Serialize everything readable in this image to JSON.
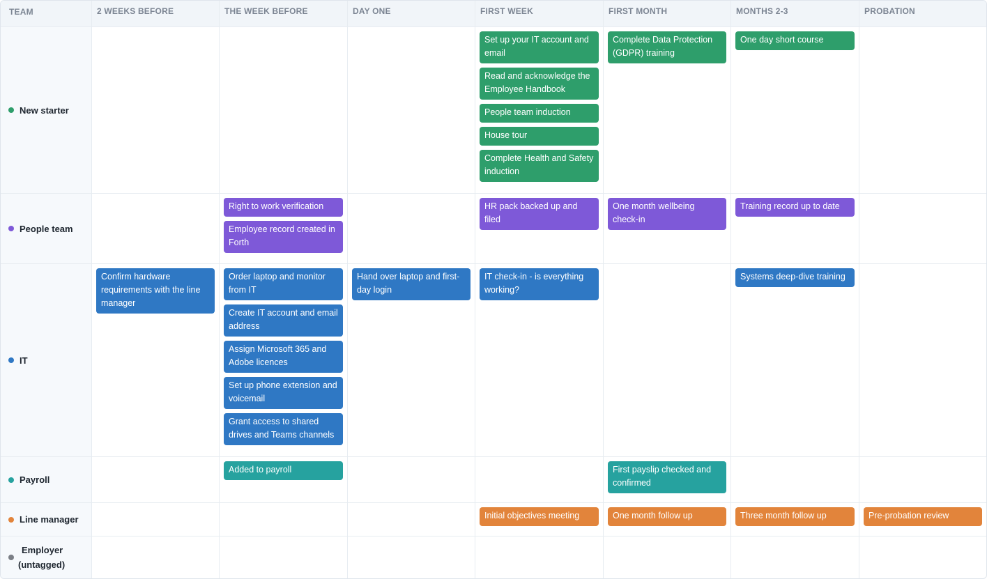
{
  "columns": {
    "team": "TEAM",
    "c1": "2 WEEKS BEFORE",
    "c2": "THE WEEK BEFORE",
    "c3": "DAY ONE",
    "c4": "FIRST WEEK",
    "c5": "FIRST MONTH",
    "c6": "MONTHS 2-3",
    "c7": "PROBATION"
  },
  "colors": {
    "new_starter": "#2e9e6b",
    "people_team": "#7e59d8",
    "it": "#2f78c4",
    "payroll": "#26a29f",
    "line_manager": "#e2843b",
    "employer": "#7b7f86"
  },
  "teams": {
    "new_starter": "New starter",
    "people_team": "People team",
    "it": "IT",
    "payroll": "Payroll",
    "line_manager": "Line manager",
    "employer_line1": "Employer",
    "employer_line2": "(untagged)"
  },
  "tasks": {
    "new_starter": {
      "first_week": [
        "Set up your IT account and email",
        "Read and acknowledge the Employee Handbook",
        "People team induction",
        "House tour",
        "Complete Health and Safety induction"
      ],
      "first_month": [
        "Complete Data Protection (GDPR) training"
      ],
      "months_2_3": [
        "One day short course"
      ]
    },
    "people_team": {
      "week_before": [
        "Right to work verification",
        "Employee record created in Forth"
      ],
      "first_week": [
        "HR pack backed up and filed"
      ],
      "first_month": [
        "One month wellbeing check-in"
      ],
      "months_2_3": [
        "Training record up to date"
      ]
    },
    "it": {
      "two_weeks_before": [
        "Confirm hardware requirements with the line manager"
      ],
      "week_before": [
        "Order laptop and monitor from IT",
        "Create IT account and email address",
        "Assign Microsoft 365 and Adobe licences",
        "Set up phone extension and voicemail",
        "Grant access to shared drives and Teams channels"
      ],
      "day_one": [
        "Hand over laptop and first-day login"
      ],
      "first_week": [
        "IT check-in - is everything working?"
      ],
      "months_2_3": [
        "Systems deep-dive training"
      ]
    },
    "payroll": {
      "week_before": [
        "Added to payroll"
      ],
      "first_month": [
        "First payslip checked and confirmed"
      ]
    },
    "line_manager": {
      "first_week": [
        "Initial objectives meeting"
      ],
      "first_month": [
        "One month follow up"
      ],
      "months_2_3": [
        "Three month follow up"
      ],
      "probation": [
        "Pre-probation review"
      ]
    }
  }
}
